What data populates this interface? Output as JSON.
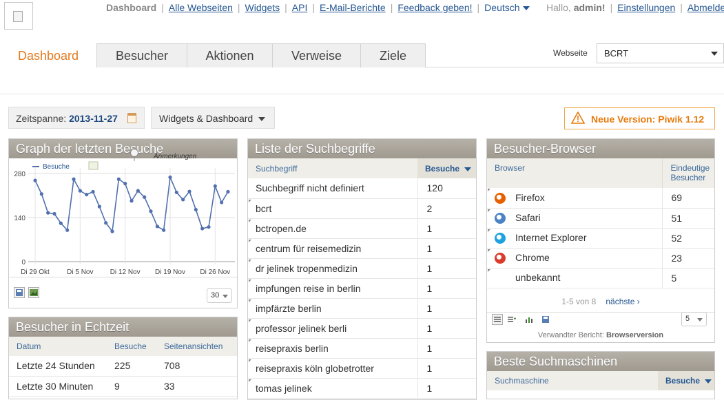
{
  "topnav": {
    "items": [
      "Dashboard",
      "Alle Webseiten",
      "Widgets",
      "API",
      "E-Mail-Berichte",
      "Feedback geben!"
    ],
    "language": "Deutsch"
  },
  "user": {
    "greeting": "Hallo,",
    "name": "admin!",
    "settings": "Einstellungen",
    "logout": "Abmelden"
  },
  "tabs": [
    "Dashboard",
    "Besucher",
    "Aktionen",
    "Verweise",
    "Ziele"
  ],
  "website": {
    "label": "Webseite",
    "value": "BCRT"
  },
  "period": {
    "label": "Zeitspanne:",
    "value": "2013-11-27"
  },
  "widgets_button": "Widgets & Dashboard",
  "new_version": "Neue Version: Piwik 1.12",
  "graph_widget": {
    "title": "Graph der letzten Besuche",
    "annotations_label": "Anmerkungen",
    "limit": "30"
  },
  "chart_data": {
    "type": "line",
    "series": [
      {
        "name": "Besuche",
        "values": [
          258,
          215,
          155,
          152,
          122,
          100,
          262,
          225,
          213,
          222,
          175,
          123,
          96,
          262,
          248,
          193,
          225,
          205,
          160,
          112,
          100,
          268,
          220,
          197,
          223,
          165,
          105,
          110,
          240,
          188,
          222
        ]
      }
    ],
    "x_ticks": [
      "Di 29 Okt",
      "Di 5 Nov",
      "Di 12 Nov",
      "Di 19 Nov",
      "Di 26 Nov"
    ],
    "y_ticks": [
      "0",
      "140",
      "280"
    ],
    "ylim": [
      0,
      280
    ],
    "grid": true,
    "legend_position": "top-left",
    "color": "#5170ae"
  },
  "live_widget": {
    "title": "Besucher in Echtzeit",
    "columns": [
      "Datum",
      "Besuche",
      "Seitenansichten"
    ],
    "rows": [
      [
        "Letzte 24 Stunden",
        "225",
        "708"
      ],
      [
        "Letzte 30 Minuten",
        "9",
        "33"
      ]
    ]
  },
  "keywords_widget": {
    "title": "Liste der Suchbegriffe",
    "columns": [
      "Suchbegriff",
      "Besuche"
    ],
    "rows": [
      [
        "Suchbegriff nicht definiert",
        "120"
      ],
      [
        "bcrt",
        "2"
      ],
      [
        "bctropen.de",
        "1"
      ],
      [
        "centrum für reisemedizin",
        "1"
      ],
      [
        "dr jelinek tropenmedizin",
        "1"
      ],
      [
        "impfungen reise in berlin",
        "1"
      ],
      [
        "impfärzte berlin",
        "1"
      ],
      [
        "professor jelinek berli",
        "1"
      ],
      [
        "reisepraxis berlin",
        "1"
      ],
      [
        "reisepraxis köln globetrotter",
        "1"
      ],
      [
        "tomas jelinek",
        "1"
      ]
    ]
  },
  "browser_widget": {
    "title": "Besucher-Browser",
    "columns": [
      "Browser",
      "Eindeutige Besucher"
    ],
    "rows": [
      {
        "name": "Firefox",
        "value": "69",
        "icon": "firefox-icon",
        "color": "#e66000"
      },
      {
        "name": "Safari",
        "value": "51",
        "icon": "safari-icon",
        "color": "#4a82c3"
      },
      {
        "name": "Internet Explorer",
        "value": "52",
        "icon": "ie-icon",
        "color": "#1ea1e0"
      },
      {
        "name": "Chrome",
        "value": "23",
        "icon": "chrome-icon",
        "color": "#d93b2b"
      },
      {
        "name": "unbekannt",
        "value": "5",
        "icon": "",
        "color": ""
      }
    ],
    "pager_range": "1-5 von 8",
    "pager_next": "nächste ›",
    "limit": "5",
    "related_label": "Verwandter Bericht:",
    "related_link": "Browserversion"
  },
  "search_widget": {
    "title": "Beste Suchmaschinen",
    "columns": [
      "Suchmaschine",
      "Besuche"
    ]
  },
  "colors": {
    "accent_orange": "#e47a1e",
    "link_blue": "#255792",
    "widget_header": "#aaa59c"
  }
}
